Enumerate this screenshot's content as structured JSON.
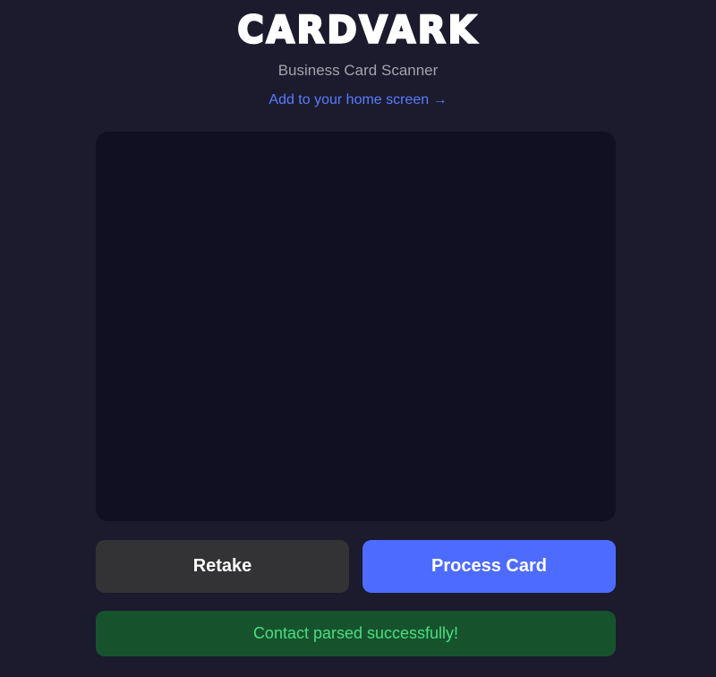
{
  "header": {
    "logo_text": "CARDVARK",
    "subtitle": "Business Card Scanner",
    "install_link": "Add to your home screen →"
  },
  "actions": {
    "retake_label": "Retake",
    "process_label": "Process Card"
  },
  "status": {
    "message": "Contact parsed successfully!"
  },
  "colors": {
    "background": "#1b1b2d",
    "camera_panel": "#101022",
    "accent": "#4d6bfe",
    "link": "#5a7bff",
    "secondary_button": "#333335",
    "success_background": "#16532d",
    "success_text": "#4ade80"
  }
}
